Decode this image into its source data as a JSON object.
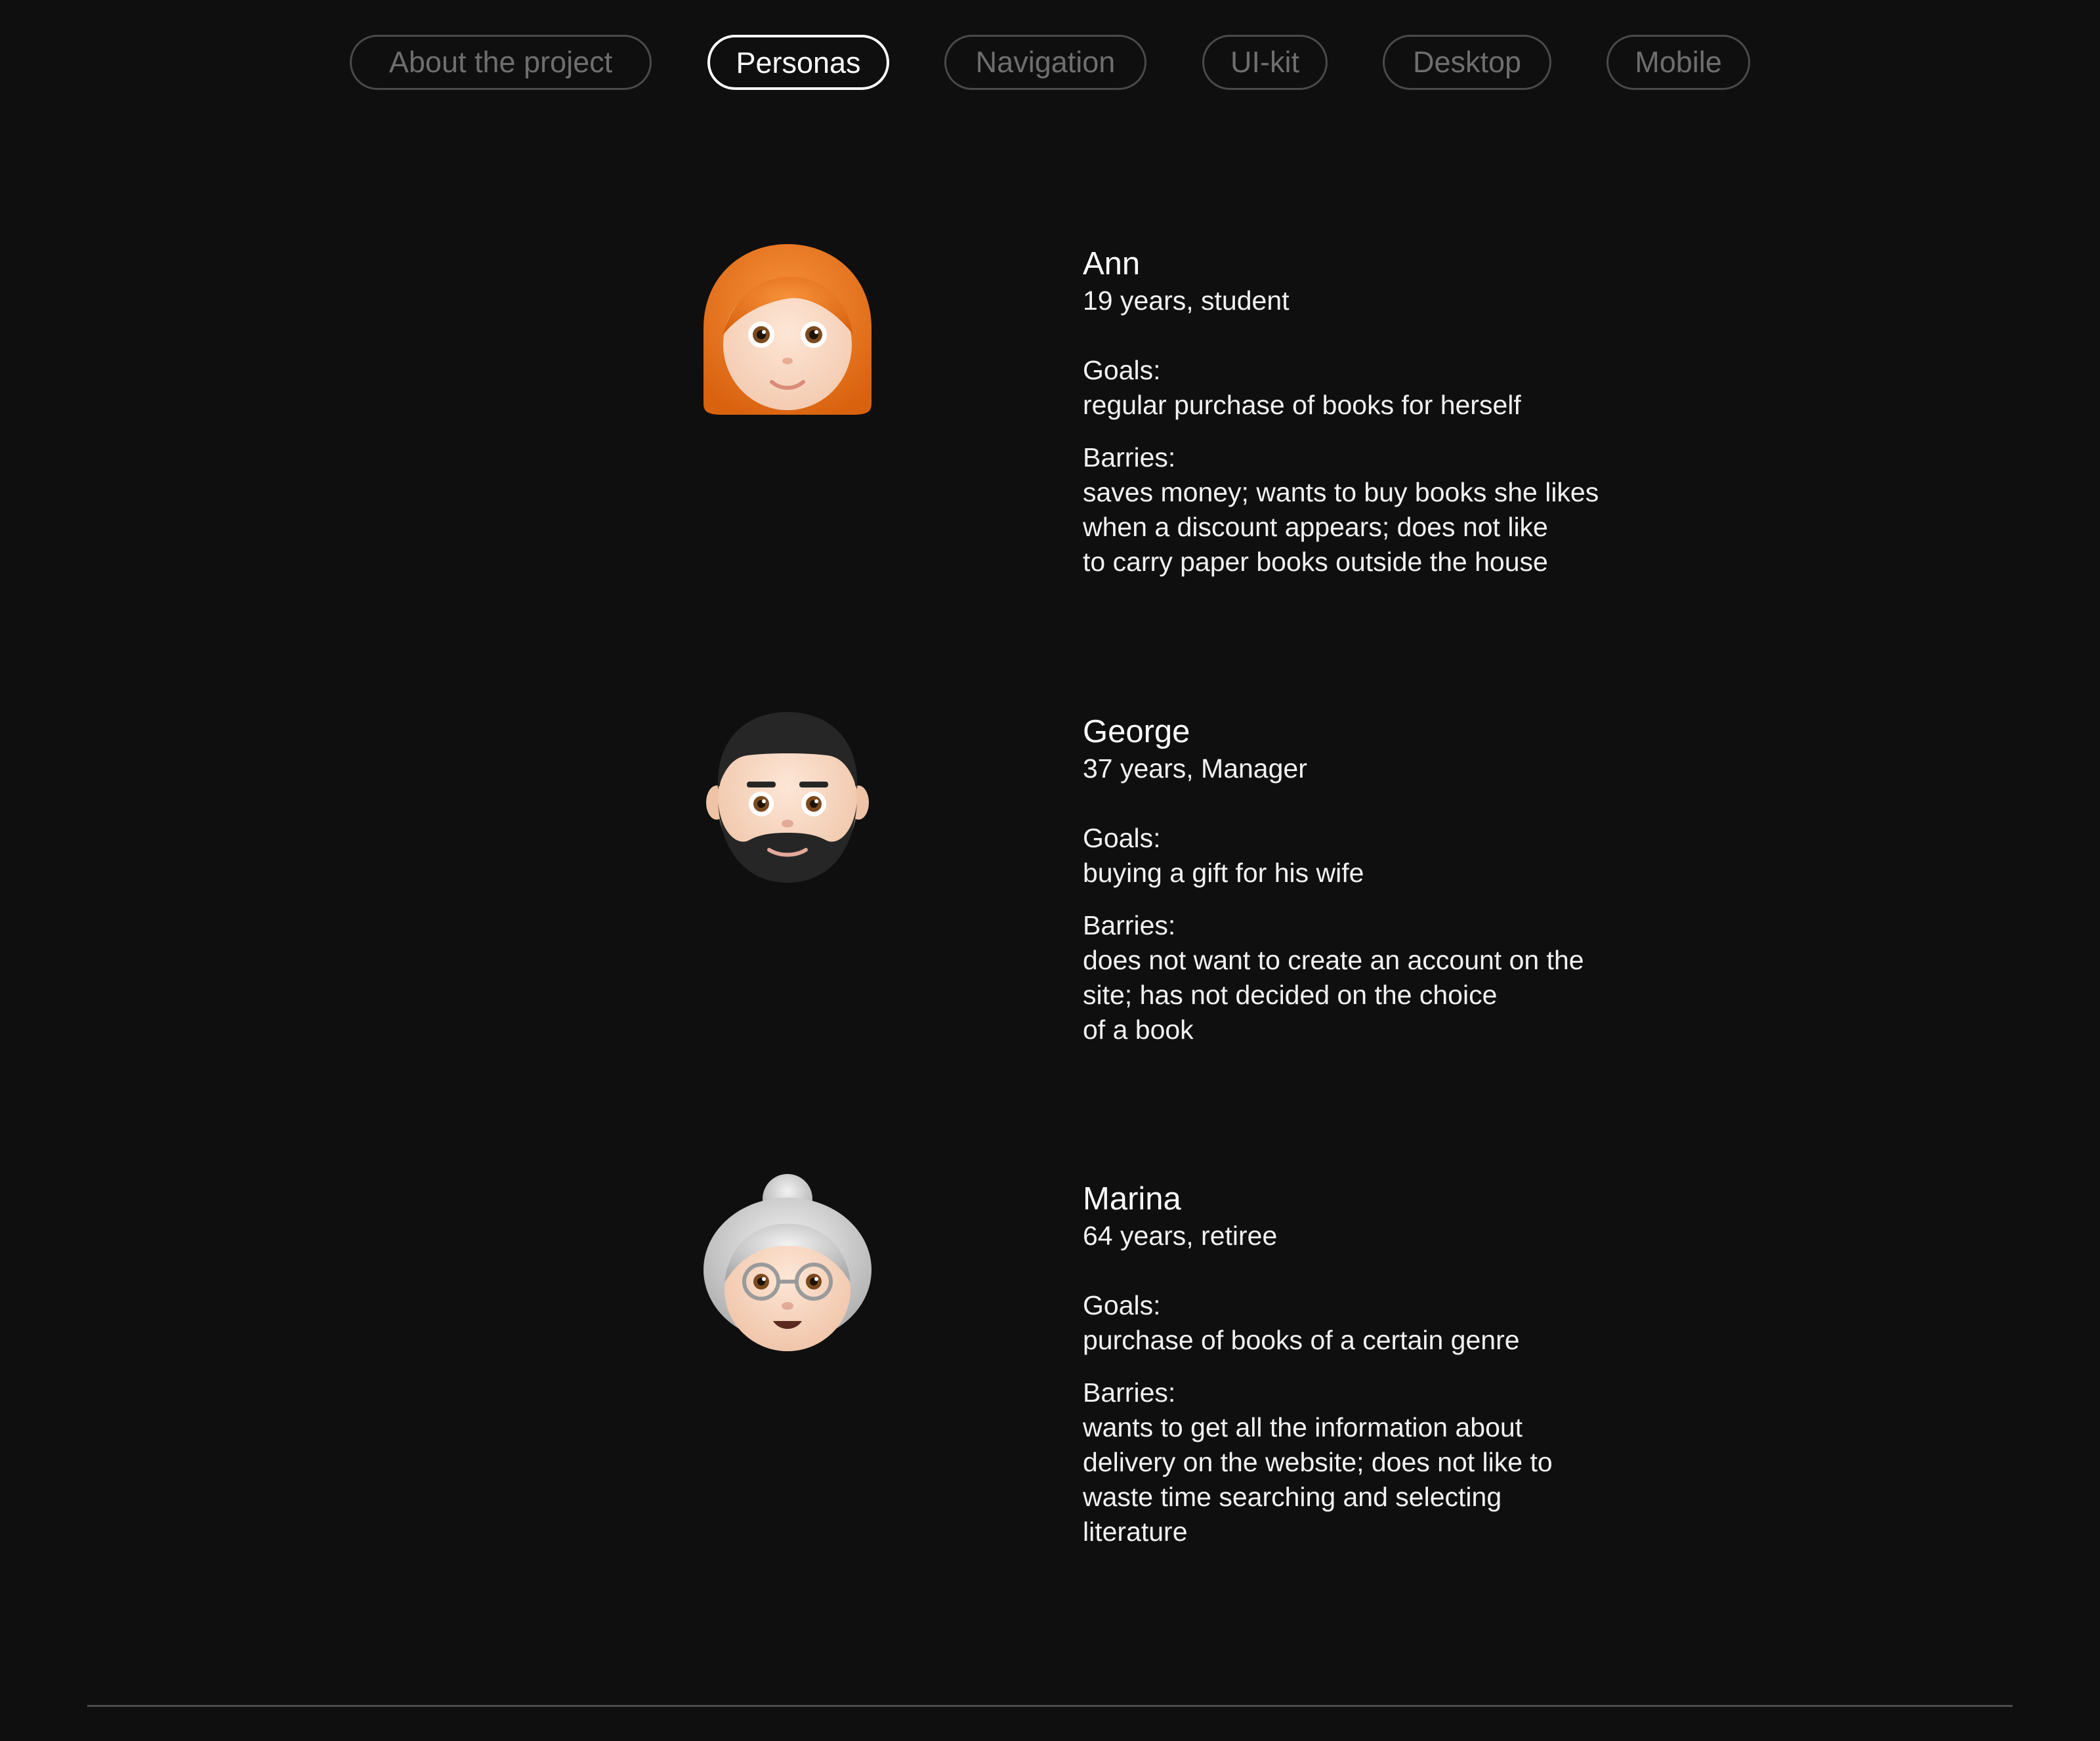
{
  "nav": {
    "items": [
      {
        "label": "About the project"
      },
      {
        "label": "Personas"
      },
      {
        "label": "Navigation"
      },
      {
        "label": "UI-kit"
      },
      {
        "label": "Desktop"
      },
      {
        "label": "Mobile"
      }
    ],
    "active": "Personas"
  },
  "personas": [
    {
      "name": "Ann",
      "meta": "19 years, student",
      "goals_label": "Goals:",
      "goals": "regular purchase of books for herself",
      "barries_label": "Barries:",
      "barries": "saves money; wants to buy books she likes\nwhen a discount appears; does not like\nto carry paper books outside the house",
      "avatar_icon": "red-haired-woman-emoji-icon"
    },
    {
      "name": "George",
      "meta": "37 years, Manager",
      "goals_label": "Goals:",
      "goals": "buying a gift for his wife",
      "barries_label": "Barries:",
      "barries": "does not want to create an account on the\nsite; has not decided on the choice\nof a book",
      "avatar_icon": "bearded-man-emoji-icon"
    },
    {
      "name": "Marina",
      "meta": "64 years, retiree",
      "goals_label": "Goals:",
      "goals": "purchase of books of a certain genre",
      "barries_label": "Barries:",
      "barries": "wants to get all the information about\ndelivery on the website; does not like to\nwaste time searching and selecting\nliterature",
      "avatar_icon": "older-woman-emoji-icon"
    }
  ],
  "colors": {
    "background": "#0f0f0f",
    "text": "#ffffff",
    "inactive_pill": "#6e6e6e",
    "divider": "#4d4d4d"
  }
}
